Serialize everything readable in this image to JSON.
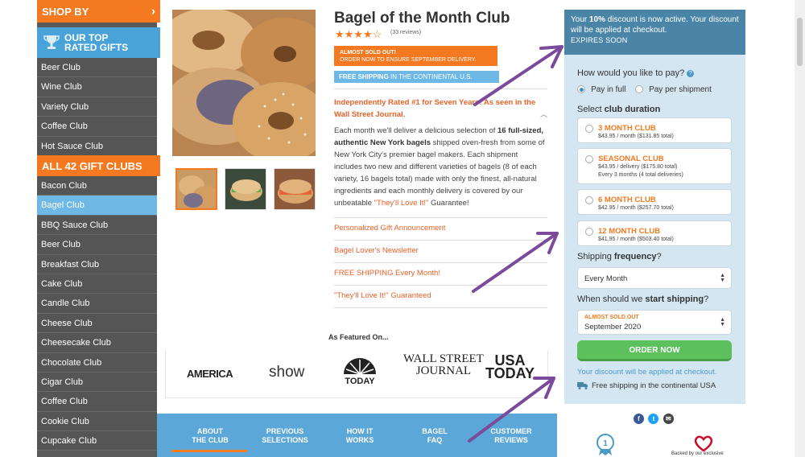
{
  "sidebar": {
    "shop_by": "SHOP BY",
    "shop_by_arrow": "›",
    "top_rated_line1": "OUR TOP",
    "top_rated_line2": "RATED GIFTS",
    "top_items": [
      "Beer Club",
      "Wine Club",
      "Variety Club",
      "Coffee Club",
      "Hot Sauce Club"
    ],
    "all_clubs": "ALL 42 GIFT CLUBS",
    "all_items": [
      "Bacon Club",
      "Bagel Club",
      "BBQ Sauce Club",
      "Beer Club",
      "Breakfast Club",
      "Cake Club",
      "Candle Club",
      "Cheese Club",
      "Cheesecake Club",
      "Chocolate Club",
      "Cigar Club",
      "Coffee Club",
      "Cookie Club",
      "Cupcake Club"
    ],
    "active_item": "Bagel Club"
  },
  "product": {
    "title": "Bagel of the Month Club",
    "stars": "★★★★☆",
    "reviews": "(33 reviews)",
    "sold_out_title": "ALMOST SOLD OUT!",
    "sold_out_sub": "ORDER NOW TO ENSURE SEPTEMBER DELIVERY.",
    "free_ship_bold": "FREE SHIPPING",
    "free_ship_rest": " IN THE CONTINENTAL U.S.",
    "rated": "Independently Rated #1 for Seven Years! As seen in the Wall Street Journal.",
    "desc_1": "Each month we'll deliver a delicious selection of ",
    "desc_bold": "16 full-sized, authentic New York bagels",
    "desc_2": " shipped oven-fresh from some of New York City's premier bagel makers. Each shipment includes two new and different varieties of bagels (8 of each variety, 16 bagels total) made with only the finest, all-natural ingredients and each monthly delivery is covered by our unbeatable ",
    "desc_link": "\"They'll Love It!\"",
    "desc_3": " Guarantee!",
    "accordion": [
      "Personalized Gift Announcement",
      "Bagel Lover's Newsletter",
      "FREE SHIPPING Every Month!",
      "\"They'll Love It!\" Guaranteed"
    ],
    "featured_title": "As Featured On...",
    "logos": [
      "AMERICA",
      "show",
      "TODAY",
      "WALL STREET",
      "JOURNAL",
      "USA",
      "TODAY"
    ]
  },
  "bottom_nav": [
    {
      "l1": "ABOUT",
      "l2": "THE CLUB"
    },
    {
      "l1": "PREVIOUS",
      "l2": "SELECTIONS"
    },
    {
      "l1": "HOW IT",
      "l2": "WORKS"
    },
    {
      "l1": "BAGEL",
      "l2": "FAQ"
    },
    {
      "l1": "CUSTOMER",
      "l2": "REVIEWS"
    }
  ],
  "panel": {
    "discount_1": "Your ",
    "discount_pct": "10%",
    "discount_2": " discount is now active. Your discount will be applied at checkout.",
    "expires": "EXPIRES SOON",
    "pay_q": "How would you like to pay?",
    "help_icon": "?",
    "pay_full": "Pay in full",
    "pay_per": "Pay per shipment",
    "duration_pre": "Select ",
    "duration_bold": "club duration",
    "options": [
      {
        "title": "3 MONTH CLUB",
        "line1": "$43.95 / month ($131.85 total)",
        "line2": ""
      },
      {
        "title": "SEASONAL CLUB",
        "line1": "$43.95 / delivery ($175.80 total)",
        "line2": "Every 3 months (4 total deliveries)"
      },
      {
        "title": "6 MONTH CLUB",
        "line1": "$42.95 / month ($257.70 total)",
        "line2": ""
      },
      {
        "title": "12 MONTH CLUB",
        "line1": "$41.95 / month ($503.40 total)",
        "line2": ""
      }
    ],
    "freq_pre": "Shipping ",
    "freq_bold": "frequency",
    "freq_post": "?",
    "freq_value": "Every Month",
    "start_pre": "When should we ",
    "start_bold": "start shipping",
    "start_post": "?",
    "start_tag": "ALMOST SOLD OUT",
    "start_value": "September 2020",
    "order_btn": "ORDER NOW",
    "discount_note": "Your discount will be applied at checkout.",
    "freeship_note": "Free shipping in the continental USA",
    "backed": "Backed by our exclusive"
  },
  "colors": {
    "orange": "#f47920",
    "blue": "#6db8e4",
    "panel_bg": "#d5e6f3",
    "discount_bg": "#4a85a8",
    "green": "#5cc15c",
    "arrow_purple": "#7b4a9a"
  }
}
